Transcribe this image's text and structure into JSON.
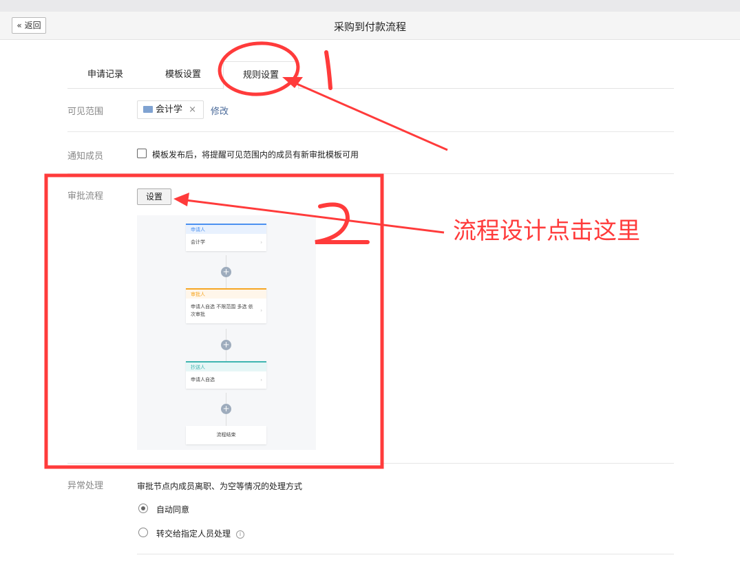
{
  "header": {
    "back_label": "« 返回",
    "title": "采购到付款流程"
  },
  "tabs": [
    {
      "label": "申请记录"
    },
    {
      "label": "模板设置"
    },
    {
      "label": "规则设置",
      "active": true
    }
  ],
  "visibility": {
    "label": "可见范围",
    "chip": "会计学",
    "chip_remove": "×",
    "edit_link": "修改"
  },
  "notify": {
    "label": "通知成员",
    "checkbox_text": "模板发布后，将提醒可见范围内的成员有新审批模板可用",
    "checked": false
  },
  "approval": {
    "label": "审批流程",
    "button": "设置",
    "flow": [
      {
        "header": "申请人",
        "body": "会计学",
        "color": "#4a90f0",
        "bg": "#e8f1fe"
      },
      {
        "header": "审批人",
        "body": "申请人自选 不限范围 多选 依次审批",
        "color": "#f6a623",
        "bg": "#fff6ea"
      },
      {
        "header": "抄送人",
        "body": "申请人自选",
        "color": "#3fb5b0",
        "bg": "#e6f6f6"
      }
    ],
    "end": "流程结束",
    "chevron": "›",
    "plus": "+"
  },
  "exception": {
    "label": "异常处理",
    "desc": "审批节点内成员离职、为空等情况的处理方式",
    "options": [
      {
        "label": "自动同意",
        "selected": true
      },
      {
        "label": "转交给指定人员处理",
        "selected": false
      }
    ],
    "info": "i"
  },
  "annotations": {
    "mark1": "1",
    "mark2": "2",
    "callout": "流程设计点击这里",
    "color": "#ff3b3b"
  }
}
